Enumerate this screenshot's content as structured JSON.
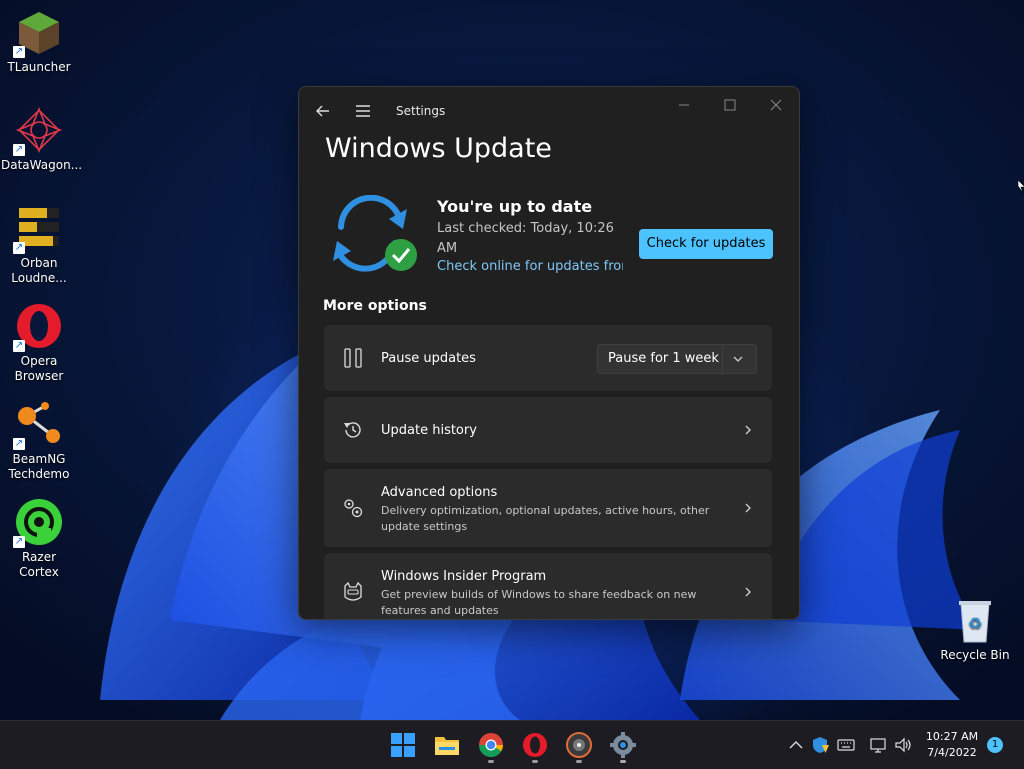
{
  "desktop": {
    "icons": [
      {
        "label": "TLauncher"
      },
      {
        "label": "DataWagon..."
      },
      {
        "label": "Orban Loudne..."
      },
      {
        "label": "Opera Browser"
      },
      {
        "label": "BeamNG Techdemo"
      },
      {
        "label": "Razer Cortex"
      },
      {
        "label": "Recycle Bin"
      }
    ]
  },
  "window": {
    "title": "Settings",
    "page_title": "Windows Update",
    "status": {
      "heading": "You're up to date",
      "last_checked": "Last checked: Today, 10:26 AM",
      "link": "Check online for updates fron"
    },
    "check_button": "Check for updates",
    "more_options": "More options",
    "cards": [
      {
        "title": "Pause updates",
        "select_value": "Pause for 1 week"
      },
      {
        "title": "Update history"
      },
      {
        "title": "Advanced options",
        "desc": "Delivery optimization, optional updates, active hours, other update settings"
      },
      {
        "title": "Windows Insider Program",
        "desc": "Get preview builds of Windows to share feedback on new features and updates"
      }
    ]
  },
  "taskbar": {
    "apps": [
      "start-icon",
      "file-explorer-icon",
      "chrome-icon",
      "opera-icon",
      "media-player-icon",
      "settings-icon"
    ],
    "clock": {
      "time": "10:27 AM",
      "date": "7/4/2022"
    },
    "notification_count": "1"
  },
  "colors": {
    "accent": "#4cc2ff",
    "window_bg": "#202020",
    "card_bg": "#2b2b2b",
    "link": "#7ec8f6",
    "success": "#2ea043"
  }
}
